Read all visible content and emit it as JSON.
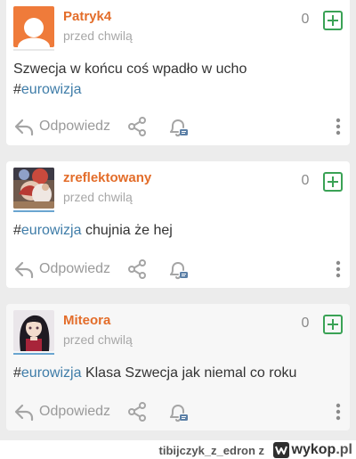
{
  "posts": [
    {
      "username": "Patryk4",
      "username_color": "#e36d2a",
      "avatar_line_color": "#e8e8e8",
      "time": "przed chwilą",
      "score": "0",
      "text": "Szwecja w końcu coś wpadło w ucho",
      "hashtag_symbol": "#",
      "hashtag": "eurowizja",
      "hashtag_position": "after",
      "reply_label": "Odpowiedz"
    },
    {
      "username": "zreflektowany",
      "username_color": "#e36d2a",
      "avatar_line_color": "#6aa5d0",
      "time": "przed chwilą",
      "score": "0",
      "hashtag_symbol": "#",
      "hashtag": "eurowizja",
      "text": " chujnia że hej",
      "hashtag_position": "before",
      "reply_label": "Odpowiedz"
    },
    {
      "username": "Miteora",
      "username_color": "#e36d2a",
      "avatar_line_color": "#6aa5d0",
      "time": "przed chwilą",
      "score": "0",
      "hashtag_symbol": "#",
      "hashtag": "eurowizja",
      "text": " Klasa Szwecja jak niemal co roku",
      "hashtag_position": "before",
      "reply_label": "Odpowiedz"
    }
  ],
  "footer": {
    "user": "tibijczyk_z_edron z",
    "logo": "wykop",
    "logo_tld": ".pl"
  },
  "colors": {
    "accent_green": "#3aa255",
    "hashtag_blue": "#3e7ca8",
    "icon_gray": "#a5a5a5",
    "bell_badge": "#5b7fa6"
  },
  "icons": {
    "reply": "reply-icon",
    "share": "share-icon",
    "notify": "bell-icon",
    "more": "more-vertical-icon",
    "plus": "plus-icon"
  }
}
